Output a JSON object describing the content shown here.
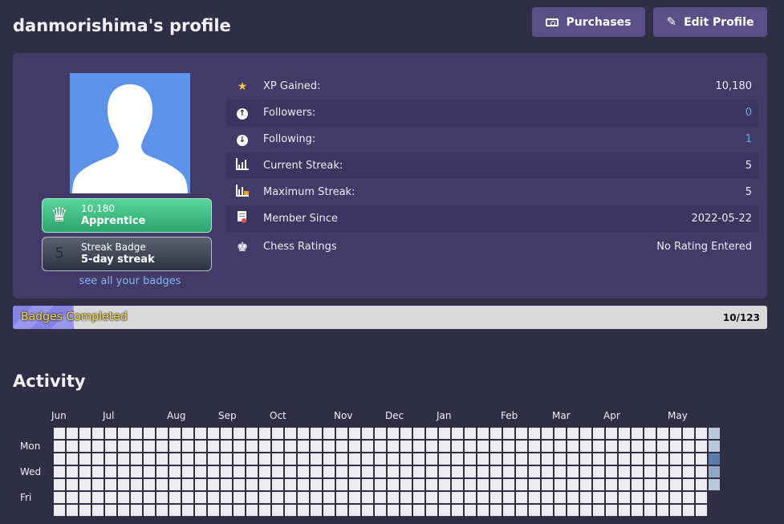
{
  "header": {
    "title": "danmorishima's profile",
    "purchases_label": "Purchases",
    "edit_profile_label": "Edit Profile"
  },
  "badges": {
    "apprentice": {
      "xp": "10,180",
      "name": "Apprentice",
      "icon": "queen-crown-icon"
    },
    "streak": {
      "number": "5",
      "title": "Streak Badge",
      "name": "5-day streak"
    },
    "see_all": "see all your badges"
  },
  "stats": [
    {
      "icon": "star-icon",
      "label": "XP Gained:",
      "value": "10,180"
    },
    {
      "icon": "arrow-up-circle-icon",
      "label": "Followers:",
      "value": "0"
    },
    {
      "icon": "arrow-down-circle-icon",
      "label": "Following:",
      "value": "1"
    },
    {
      "icon": "streak-chart-icon",
      "label": "Current Streak:",
      "value": "5"
    },
    {
      "icon": "max-streak-chart-icon",
      "label": "Maximum Streak:",
      "value": "5"
    },
    {
      "icon": "member-certificate-icon",
      "label": "Member Since",
      "value": "2022-05-22"
    },
    {
      "icon": "chess-king-icon",
      "label": "Chess Ratings",
      "value": "No Rating Entered"
    }
  ],
  "progress": {
    "label": "Badges Completed",
    "count": "10/123",
    "completed": 10,
    "total": 123
  },
  "activity": {
    "title": "Activity",
    "months": [
      "Jun",
      "Jul",
      "Aug",
      "Sep",
      "Oct",
      "Nov",
      "Dec",
      "Jan",
      "Feb",
      "Mar",
      "Apr",
      "May"
    ],
    "month_week_index": [
      0,
      4,
      9,
      13,
      17,
      22,
      26,
      30,
      35,
      39,
      43,
      48
    ],
    "day_labels": [
      "",
      "Mon",
      "",
      "Wed",
      "",
      "Fri",
      ""
    ],
    "weeks": 52,
    "last_week_days": 5,
    "active_days": [
      {
        "week": 51,
        "day": 0,
        "level": 1
      },
      {
        "week": 51,
        "day": 1,
        "level": 1
      },
      {
        "week": 51,
        "day": 2,
        "level": 3
      },
      {
        "week": 51,
        "day": 3,
        "level": 2
      },
      {
        "week": 51,
        "day": 4,
        "level": 1
      }
    ],
    "colors": {
      "empty": "#ececee",
      "level1": "#b9c9da",
      "level2": "#8fa8c6",
      "level3": "#587ea9"
    }
  },
  "colors": {
    "background": "#302e45",
    "card": "#423a67",
    "button": "#5a4f87",
    "link": "#6aa9f2",
    "progress_fill": "#8782e6"
  }
}
